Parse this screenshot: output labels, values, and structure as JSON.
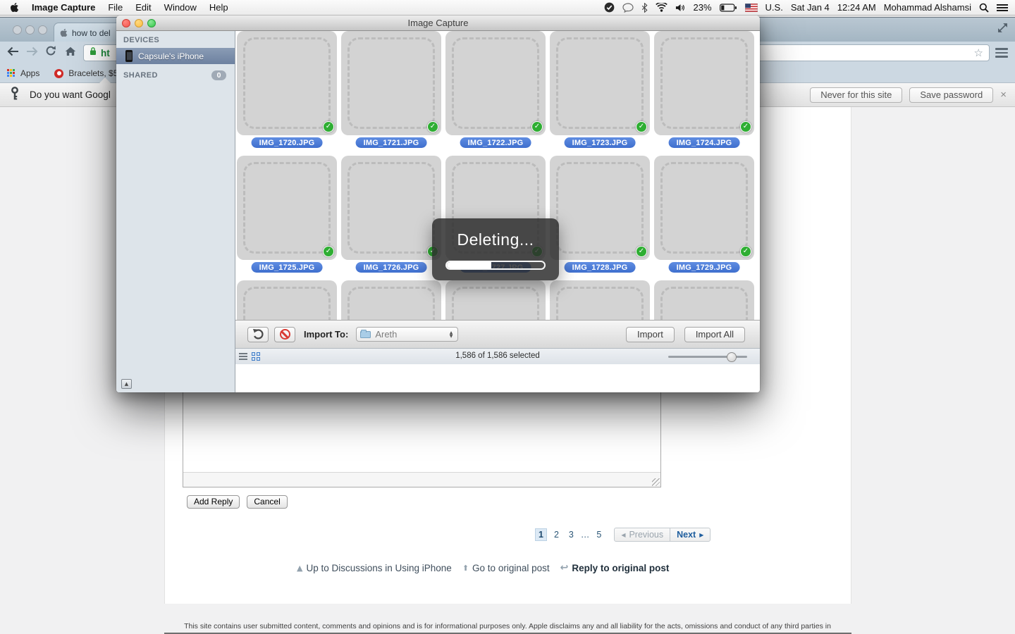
{
  "menubar": {
    "app_name": "Image Capture",
    "menus": [
      "File",
      "Edit",
      "Window",
      "Help"
    ],
    "battery": "23%",
    "input_label": "U.S.",
    "date": "Sat Jan 4",
    "time": "12:24 AM",
    "user": "Mohammad Alshamsi",
    "status_icons": [
      "check-circle",
      "chat-bubble",
      "bluetooth",
      "wifi",
      "volume",
      "battery",
      "us-flag",
      "spotlight-search",
      "notification-list"
    ]
  },
  "chrome": {
    "tab_title": "how to del",
    "url_prefix": "ht",
    "bookmarks": {
      "apps": "Apps",
      "bracelets": "Bracelets, $5"
    },
    "infobar": {
      "message": "Do you want Googl",
      "never_button": "Never for this site",
      "save_button": "Save password",
      "close": "×"
    }
  },
  "image_capture": {
    "window_title": "Image Capture",
    "sidebar": {
      "devices_header": "DEVICES",
      "device_name": "Capsule's iPhone",
      "shared_header": "SHARED",
      "shared_count": "0"
    },
    "files": [
      "IMG_1720.JPG",
      "IMG_1721.JPG",
      "IMG_1722.JPG",
      "IMG_1723.JPG",
      "IMG_1724.JPG",
      "IMG_1725.JPG",
      "IMG_1726.JPG",
      "IMG_1727.JPG",
      "IMG_1728.JPG",
      "IMG_1729.JPG"
    ],
    "overlay": {
      "label": "Deleting...",
      "progress_percent": 46
    },
    "toolbar": {
      "import_to_label": "Import To:",
      "destination": "Areth",
      "import_button": "Import",
      "import_all_button": "Import All"
    },
    "statusbar": {
      "selection": "1,586 of 1,586 selected"
    },
    "colors": {
      "label_pill": "#4a7ad0",
      "check_badge": "#2fae33",
      "selected_row": "#7b8fab"
    }
  },
  "webpage": {
    "add_reply_button": "Add Reply",
    "cancel_button": "Cancel",
    "pagination": {
      "pages": [
        "1",
        "2",
        "3",
        "…",
        "5"
      ],
      "previous": "Previous",
      "next": "Next"
    },
    "links": [
      "Up to Discussions in Using iPhone",
      "Go to original post",
      "Reply to original post"
    ],
    "footer": "This site contains user submitted content, comments and opinions and is for informational purposes only. Apple disclaims any and all liability for the acts, omissions and conduct of any third parties in"
  }
}
